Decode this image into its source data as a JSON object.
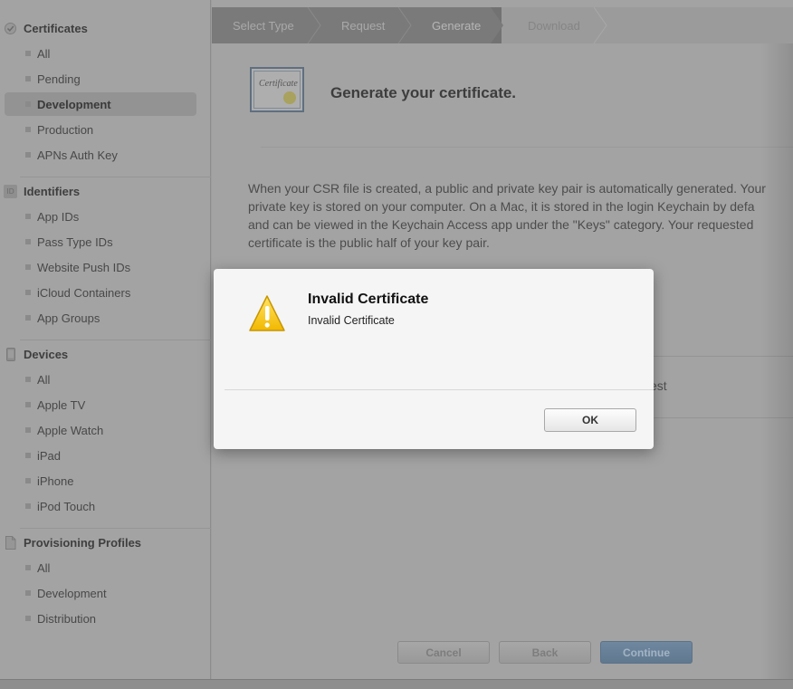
{
  "sidebar": {
    "sections": [
      {
        "title": "Certificates",
        "icon": "certificate-icon",
        "items": [
          "All",
          "Pending",
          "Development",
          "Production",
          "APNs Auth Key"
        ],
        "active": "Development"
      },
      {
        "title": "Identifiers",
        "icon": "id-icon",
        "icon_text": "ID",
        "items": [
          "App IDs",
          "Pass Type IDs",
          "Website Push IDs",
          "iCloud Containers",
          "App Groups"
        ]
      },
      {
        "title": "Devices",
        "icon": "device-icon",
        "items": [
          "All",
          "Apple TV",
          "Apple Watch",
          "iPad",
          "iPhone",
          "iPod Touch"
        ]
      },
      {
        "title": "Provisioning Profiles",
        "icon": "document-icon",
        "items": [
          "All",
          "Development",
          "Distribution"
        ]
      }
    ]
  },
  "steps": [
    {
      "label": "Select Type"
    },
    {
      "label": "Request"
    },
    {
      "label": "Generate",
      "current": true
    },
    {
      "label": "Download"
    }
  ],
  "main": {
    "title": "Generate your certificate.",
    "cert_icon_text": "Certificate",
    "description": [
      "When your CSR file is created, a public and private key pair is automatically generated. Your",
      "private key is stored on your computer. On a Mac, it is stored in the login Keychain by defa",
      "and can be viewed in the Keychain Access app under the \"Keys\" category. Your requested",
      "certificate is the public half of your key pair."
    ],
    "partial_text": "est"
  },
  "buttons": {
    "cancel": "Cancel",
    "back": "Back",
    "continue": "Continue"
  },
  "dialog": {
    "title": "Invalid Certificate",
    "message": "Invalid Certificate",
    "ok": "OK",
    "icon": "warning-icon"
  },
  "colors": {
    "accent_button": "#6f879f",
    "warning_yellow": "#f5c400"
  }
}
